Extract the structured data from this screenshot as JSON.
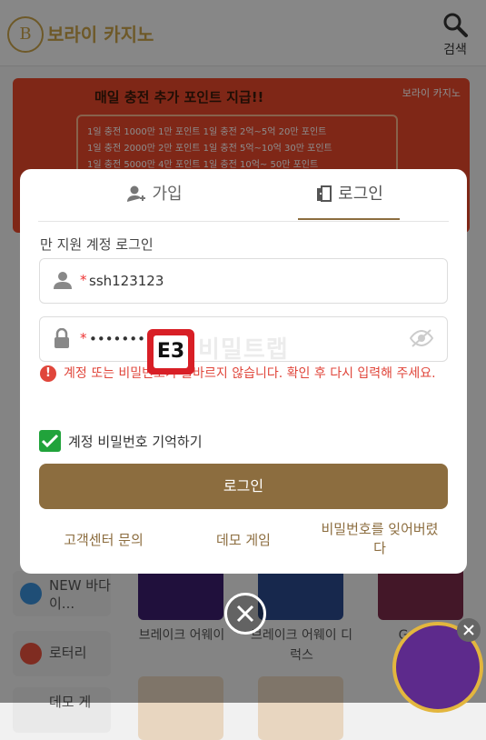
{
  "header": {
    "logo_mark": "B",
    "logo_text": "보라이 카지노",
    "search_label": "검색"
  },
  "banner": {
    "title": "매일 충전 추가 포인트 지급!!",
    "logo_text": "보라이 카지노",
    "rows": [
      "1일 충전 1000만    1만 포인트        1일 충전 2억~5억     20만 포인트",
      "1일 충전 2000만    2만 포인트        1일 충전 5억~10억    30만 포인트",
      "1일 충전 5000만    4만 포인트        1일 충전 10억~       50만 포인트"
    ]
  },
  "side_menu": {
    "items": [
      {
        "label": "NEW 바다이..."
      },
      {
        "label": "로터리"
      },
      {
        "label": "데모 게"
      }
    ]
  },
  "games": [
    {
      "title": "브레이크 어웨이"
    },
    {
      "title": "브레이크 어웨이 디럭스"
    },
    {
      "title": "G"
    }
  ],
  "modal": {
    "tabs": {
      "join": "가입",
      "login": "로그인"
    },
    "section_title": "만 지원 계정 로그인",
    "username": {
      "required_mark": "*",
      "value": "ssh123123"
    },
    "password": {
      "required_mark": "*",
      "value": "••••••••••••"
    },
    "error_icon": "!",
    "error_message": "계정 또는 비밀번호가 올바르지 않습니다. 확인 후 다시 입력해 주세요.",
    "remember_label": "계정 비밀번호 기억하기",
    "remember_checked": true,
    "login_button": "로그인",
    "links": {
      "support": "고객센터 문의",
      "demo": "데모 게임",
      "forgot": "비밀번호를 잊어버렸다"
    }
  },
  "watermark": {
    "mark": "E3",
    "text": "비밀트랩"
  },
  "colors": {
    "accent": "#8c6d3f",
    "error": "#e0463b",
    "check": "#21a33b",
    "brand_gold": "#c9a24a"
  }
}
